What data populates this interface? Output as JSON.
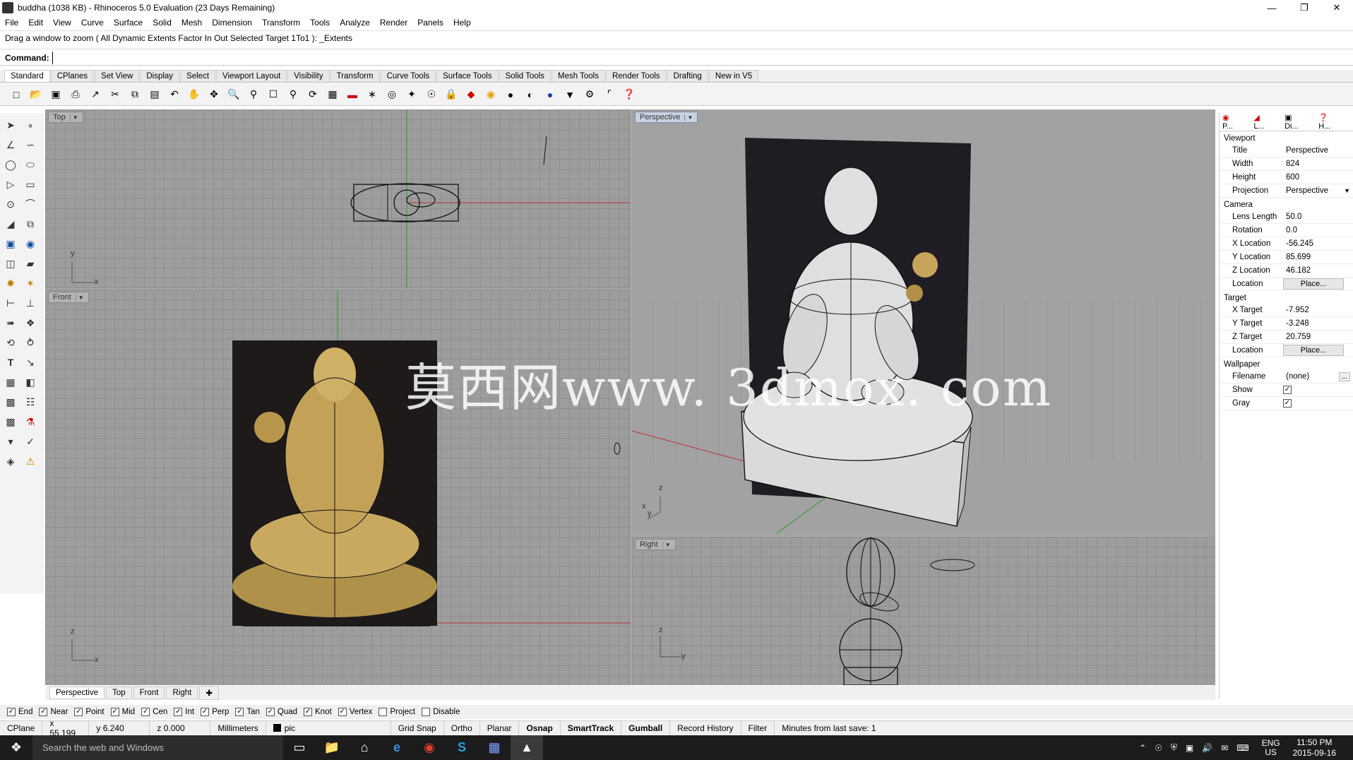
{
  "window": {
    "title": "buddha (1038 KB) - Rhinoceros 5.0 Evaluation (23 Days Remaining)"
  },
  "menu": [
    "File",
    "Edit",
    "View",
    "Curve",
    "Surface",
    "Solid",
    "Mesh",
    "Dimension",
    "Transform",
    "Tools",
    "Analyze",
    "Render",
    "Panels",
    "Help"
  ],
  "history": "Drag a window to zoom ( All  Dynamic  Extents  Factor  In  Out  Selected  Target  1To1 ): _Extents",
  "command": {
    "label": "Command:"
  },
  "toolbar_tabs": [
    "Standard",
    "CPlanes",
    "Set View",
    "Display",
    "Select",
    "Viewport Layout",
    "Visibility",
    "Transform",
    "Curve Tools",
    "Surface Tools",
    "Solid Tools",
    "Mesh Tools",
    "Render Tools",
    "Drafting",
    "New in V5"
  ],
  "viewports": {
    "top": {
      "label": "Top"
    },
    "front": {
      "label": "Front"
    },
    "perspective": {
      "label": "Perspective"
    },
    "right": {
      "label": "Right"
    }
  },
  "axis": {
    "x": "x",
    "y": "y",
    "z": "z"
  },
  "watermark": "莫西网www. 3dmox. com",
  "viewport_tabs": [
    "Perspective",
    "Top",
    "Front",
    "Right"
  ],
  "properties": {
    "tabs": [
      "P...",
      "L...",
      "Di...",
      "H..."
    ],
    "viewport_section": "Viewport",
    "viewport": [
      {
        "k": "Title",
        "v": "Perspective"
      },
      {
        "k": "Width",
        "v": "824"
      },
      {
        "k": "Height",
        "v": "600"
      },
      {
        "k": "Projection",
        "v": "Perspective"
      }
    ],
    "camera_section": "Camera",
    "camera": [
      {
        "k": "Lens Length",
        "v": "50.0"
      },
      {
        "k": "Rotation",
        "v": "0.0"
      },
      {
        "k": "X Location",
        "v": "-56.245"
      },
      {
        "k": "Y Location",
        "v": "85.699"
      },
      {
        "k": "Z Location",
        "v": "46.182"
      }
    ],
    "camera_location": {
      "k": "Location",
      "btn": "Place..."
    },
    "target_section": "Target",
    "target": [
      {
        "k": "X Target",
        "v": "-7.952"
      },
      {
        "k": "Y Target",
        "v": "-3.248"
      },
      {
        "k": "Z Target",
        "v": "20.759"
      }
    ],
    "target_location": {
      "k": "Location",
      "btn": "Place..."
    },
    "wallpaper_section": "Wallpaper",
    "wallpaper": {
      "filename_k": "Filename",
      "filename_v": "(none)",
      "browse": "...",
      "show_k": "Show",
      "gray_k": "Gray"
    }
  },
  "osnaps": [
    {
      "label": "End",
      "checked": true
    },
    {
      "label": "Near",
      "checked": true
    },
    {
      "label": "Point",
      "checked": true
    },
    {
      "label": "Mid",
      "checked": true
    },
    {
      "label": "Cen",
      "checked": true
    },
    {
      "label": "Int",
      "checked": true
    },
    {
      "label": "Perp",
      "checked": true
    },
    {
      "label": "Tan",
      "checked": true
    },
    {
      "label": "Quad",
      "checked": true
    },
    {
      "label": "Knot",
      "checked": true
    },
    {
      "label": "Vertex",
      "checked": true
    },
    {
      "label": "Project",
      "checked": false
    },
    {
      "label": "Disable",
      "checked": false
    }
  ],
  "status": {
    "cplane": "CPlane",
    "x": "x 55.199",
    "y": "y 6.240",
    "z": "z 0.000",
    "units": "Millimeters",
    "layer": "pic",
    "gridsnap": "Grid Snap",
    "ortho": "Ortho",
    "planar": "Planar",
    "osnap": "Osnap",
    "smarttrack": "SmartTrack",
    "gumball": "Gumball",
    "record": "Record History",
    "filter": "Filter",
    "lastsave": "Minutes from last save: 1"
  },
  "taskbar": {
    "search": "Search the web and Windows",
    "lang1": "ENG",
    "lang2": "US",
    "time": "11:50 PM",
    "date": "2015-09-16"
  }
}
